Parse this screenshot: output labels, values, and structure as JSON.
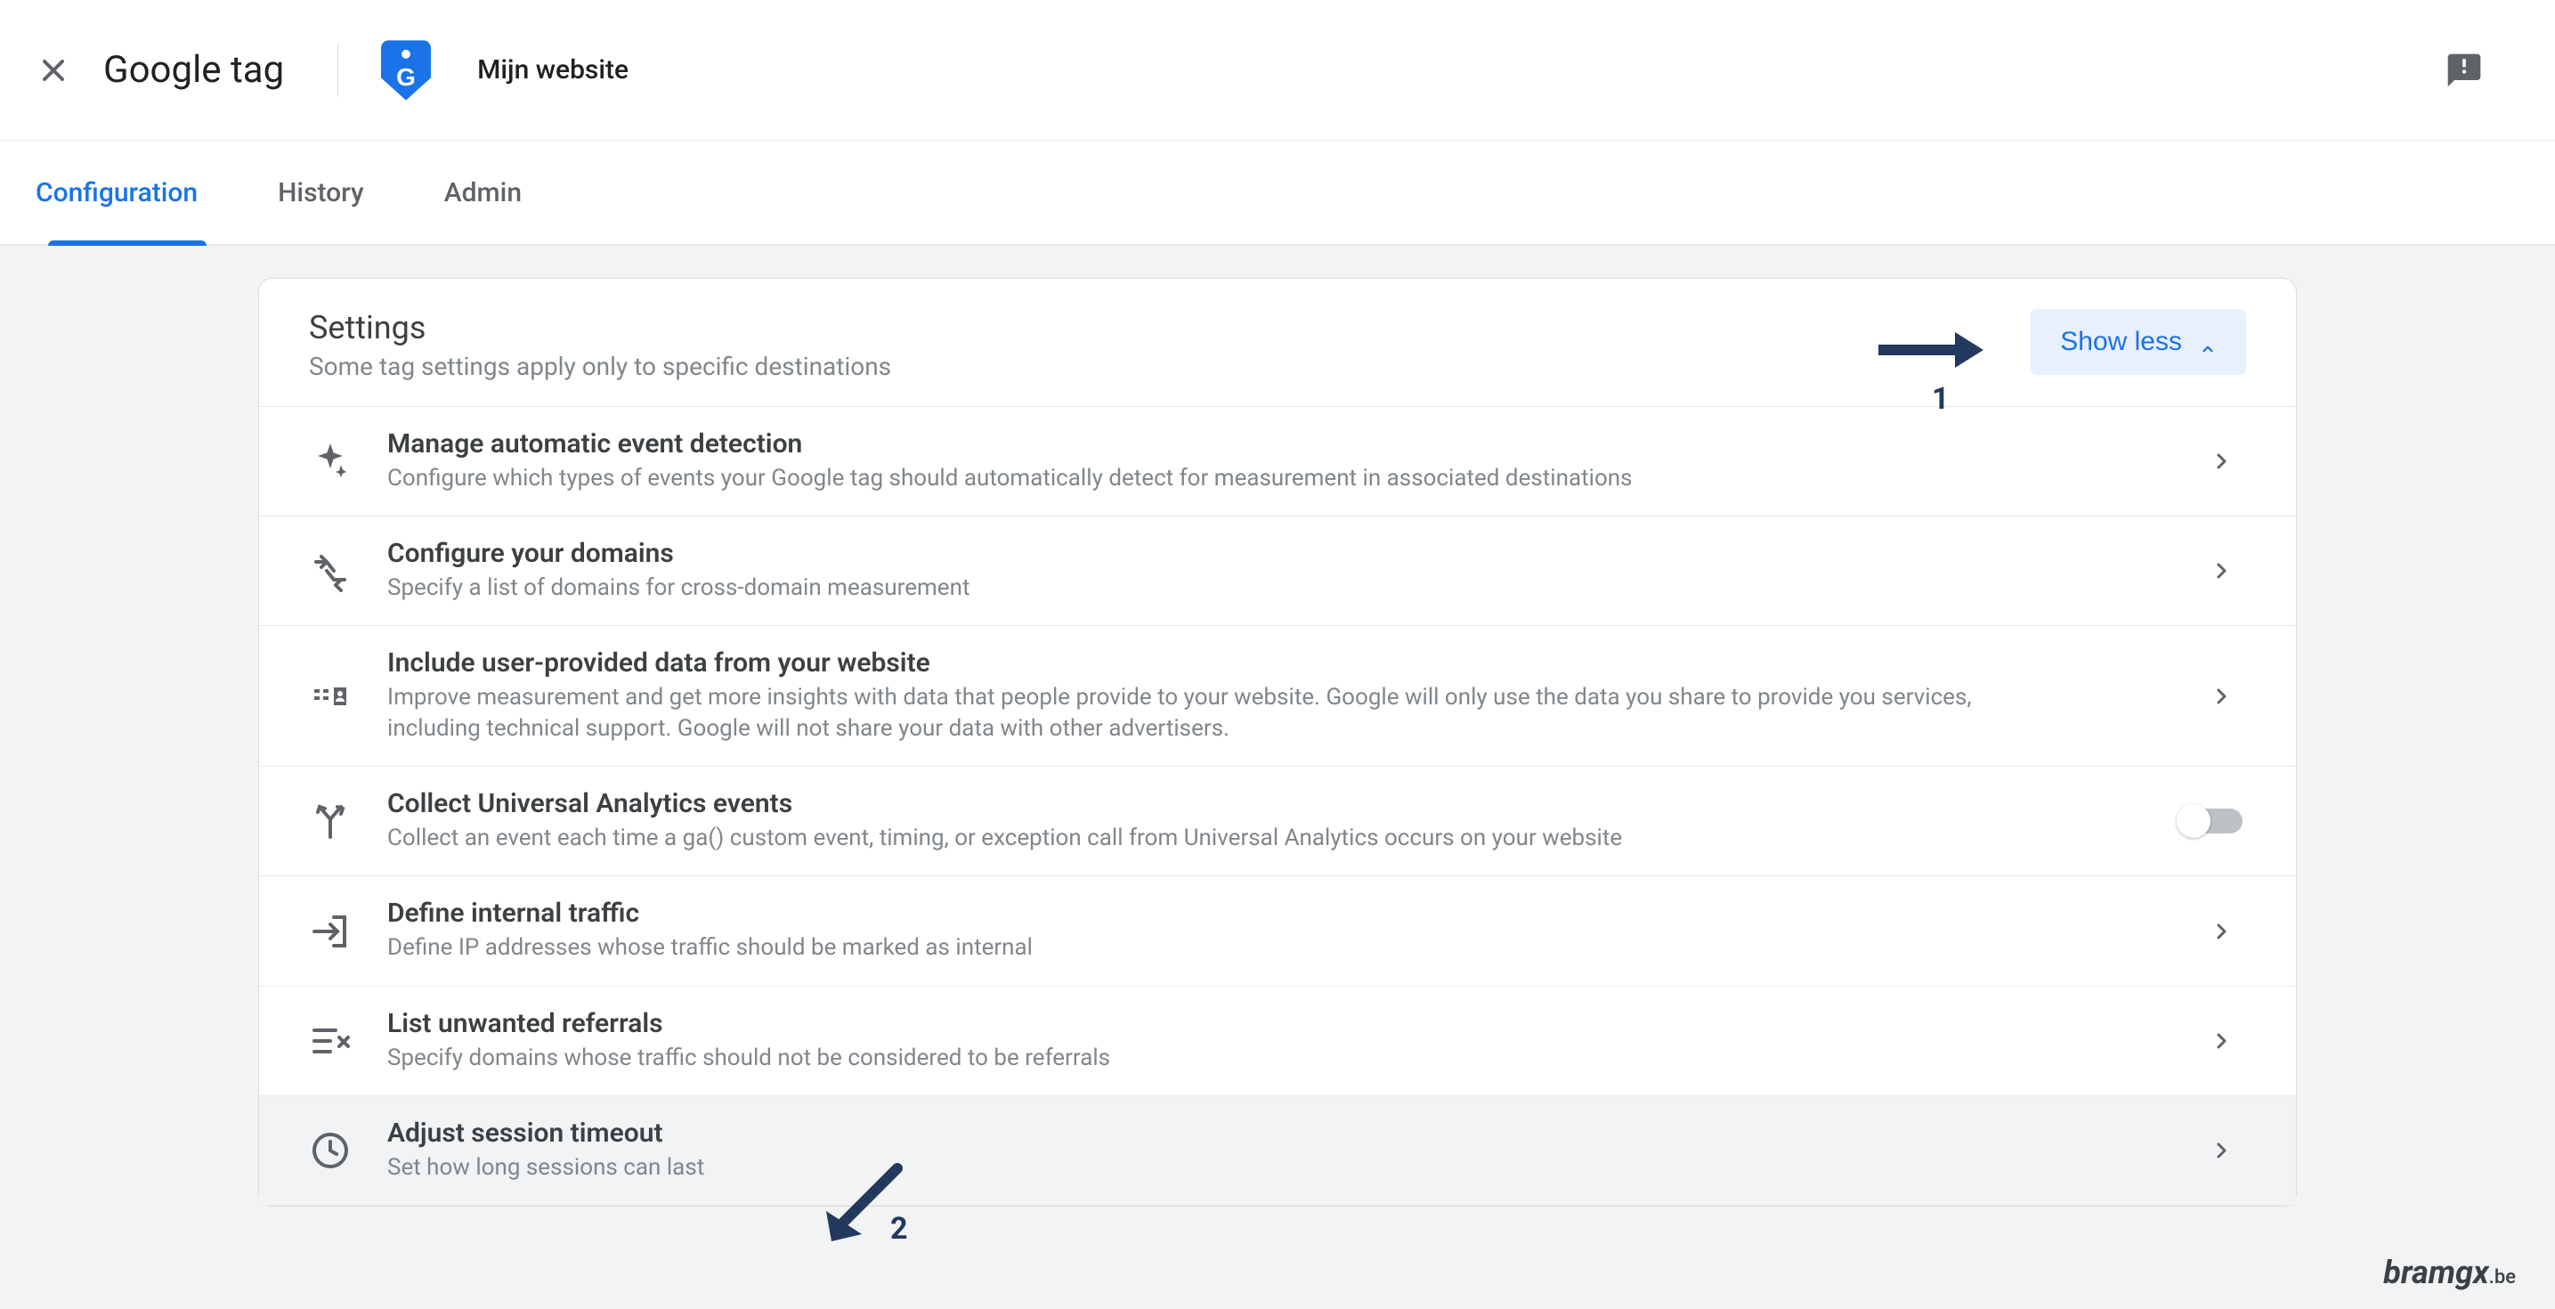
{
  "header": {
    "page_title": "Google tag",
    "site_name": "Mijn website"
  },
  "tabs": [
    {
      "label": "Configuration",
      "active": true
    },
    {
      "label": "History",
      "active": false
    },
    {
      "label": "Admin",
      "active": false
    }
  ],
  "settings_card": {
    "title": "Settings",
    "subtitle": "Some tag settings apply only to specific destinations",
    "toggle_label": "Show less"
  },
  "rows": [
    {
      "icon": "sparkle-icon",
      "title": "Manage automatic event detection",
      "desc": "Configure which types of events your Google tag should automatically detect for measurement in associated destinations",
      "action": "chevron"
    },
    {
      "icon": "merge-icon",
      "title": "Configure your domains",
      "desc": "Specify a list of domains for cross-domain measurement",
      "action": "chevron"
    },
    {
      "icon": "id-card-icon",
      "title": "Include user-provided data from your website",
      "desc": "Improve measurement and get more insights with data that people provide to your website. Google will only use the data you share to provide you services, including technical support. Google will not share your data with other advertisers.",
      "action": "chevron"
    },
    {
      "icon": "split-icon",
      "title": "Collect Universal Analytics events",
      "desc": "Collect an event each time a ga() custom event, timing, or exception call from Universal Analytics occurs on your website",
      "action": "toggle",
      "toggle_on": false
    },
    {
      "icon": "exit-icon",
      "title": "Define internal traffic",
      "desc": "Define IP addresses whose traffic should be marked as internal",
      "action": "chevron"
    },
    {
      "icon": "filter-x-icon",
      "title": "List unwanted referrals",
      "desc": "Specify domains whose traffic should not be considered to be referrals",
      "action": "chevron"
    },
    {
      "icon": "clock-icon",
      "title": "Adjust session timeout",
      "desc": "Set how long sessions can last",
      "action": "chevron",
      "highlight": true
    }
  ],
  "annotations": {
    "one": "1",
    "two": "2"
  },
  "watermark": {
    "name": "bramgx",
    "tld": ".be"
  },
  "colors": {
    "accent": "#1a73e8",
    "annotation": "#23395d"
  }
}
